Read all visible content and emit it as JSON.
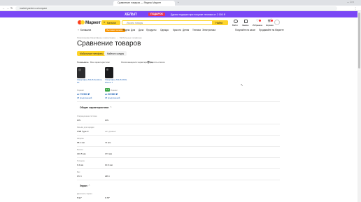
{
  "browser": {
    "tab_title": "Сравнение товаров — Яндекс Маркет",
    "url": "market.yandex.ru/compare"
  },
  "promo": {
    "brand": "ХЕЛЬП",
    "badge": "ПОДАРОК",
    "text": "Дарим подарки при покупке техники от 2 000 ₽"
  },
  "header": {
    "logo": "Маркет",
    "catalog_button": "Каталог",
    "search_placeholder": "Искать товары",
    "search_button": "Найти",
    "location": "Балашиха",
    "chip": "Бытовая техника",
    "nav": [
      "Яндекс",
      "Дом",
      "Дача",
      "Продукты",
      "Одежда",
      "Красота",
      "Детям",
      "Техника",
      "Электроника"
    ],
    "user_links": [
      "Войти",
      "Заказы",
      "Избранное",
      "Корзина"
    ],
    "right_links": [
      "Покупайте на кассе",
      "Продавайте на Маркете"
    ]
  },
  "breadcrumbs": [
    "Электроника",
    "Смартфоны и аксессуары",
    "Мобильные телефоны"
  ],
  "page_title": "Сравнение товаров",
  "filter_tabs": [
    "Мобильные телефоны",
    "Кабели и шнуры"
  ],
  "toggles": {
    "show": "Показывать:",
    "all": "Все характеристики",
    "diff": "Различающиеся характеристики",
    "clear": "Удалить список"
  },
  "products": [
    {
      "name": "Смартфон ASUS Zenfone 10",
      "price": "от 76 500 ₽",
      "offers": "38 предложений",
      "tag": ""
    },
    {
      "name": "Смартфон ASUS ROG Phone 7",
      "price": "от 85 589 ₽",
      "offers": "38 предложений",
      "tag": "4.8"
    }
  ],
  "rating_label": "Оценки",
  "general": {
    "title": "Общие характеристики",
    "rows": [
      {
        "label": "Операционная система",
        "a": "iOS",
        "b": "iOS"
      },
      {
        "label": "Разъём для зарядки",
        "a": "USB Type-C",
        "b": "нет данных"
      },
      {
        "label": "Ширина",
        "a": "68.1 мм",
        "b": "71 мм"
      },
      {
        "label": "Высота",
        "a": "146.5 мм",
        "b": "173 мм"
      },
      {
        "label": "Толщина",
        "a": "9.4 мм",
        "b": "10.3 мм"
      },
      {
        "label": "Вес",
        "a": "172 г",
        "b": "239 г"
      }
    ]
  },
  "screen": {
    "title": "Экран",
    "row": {
      "label": "Диагональ экрана",
      "a": "5.92\"",
      "b": "6.78\""
    }
  },
  "colors": {
    "purple": "#7a47f5",
    "yellow": "#fed42b",
    "link": "#1a5fb4"
  }
}
